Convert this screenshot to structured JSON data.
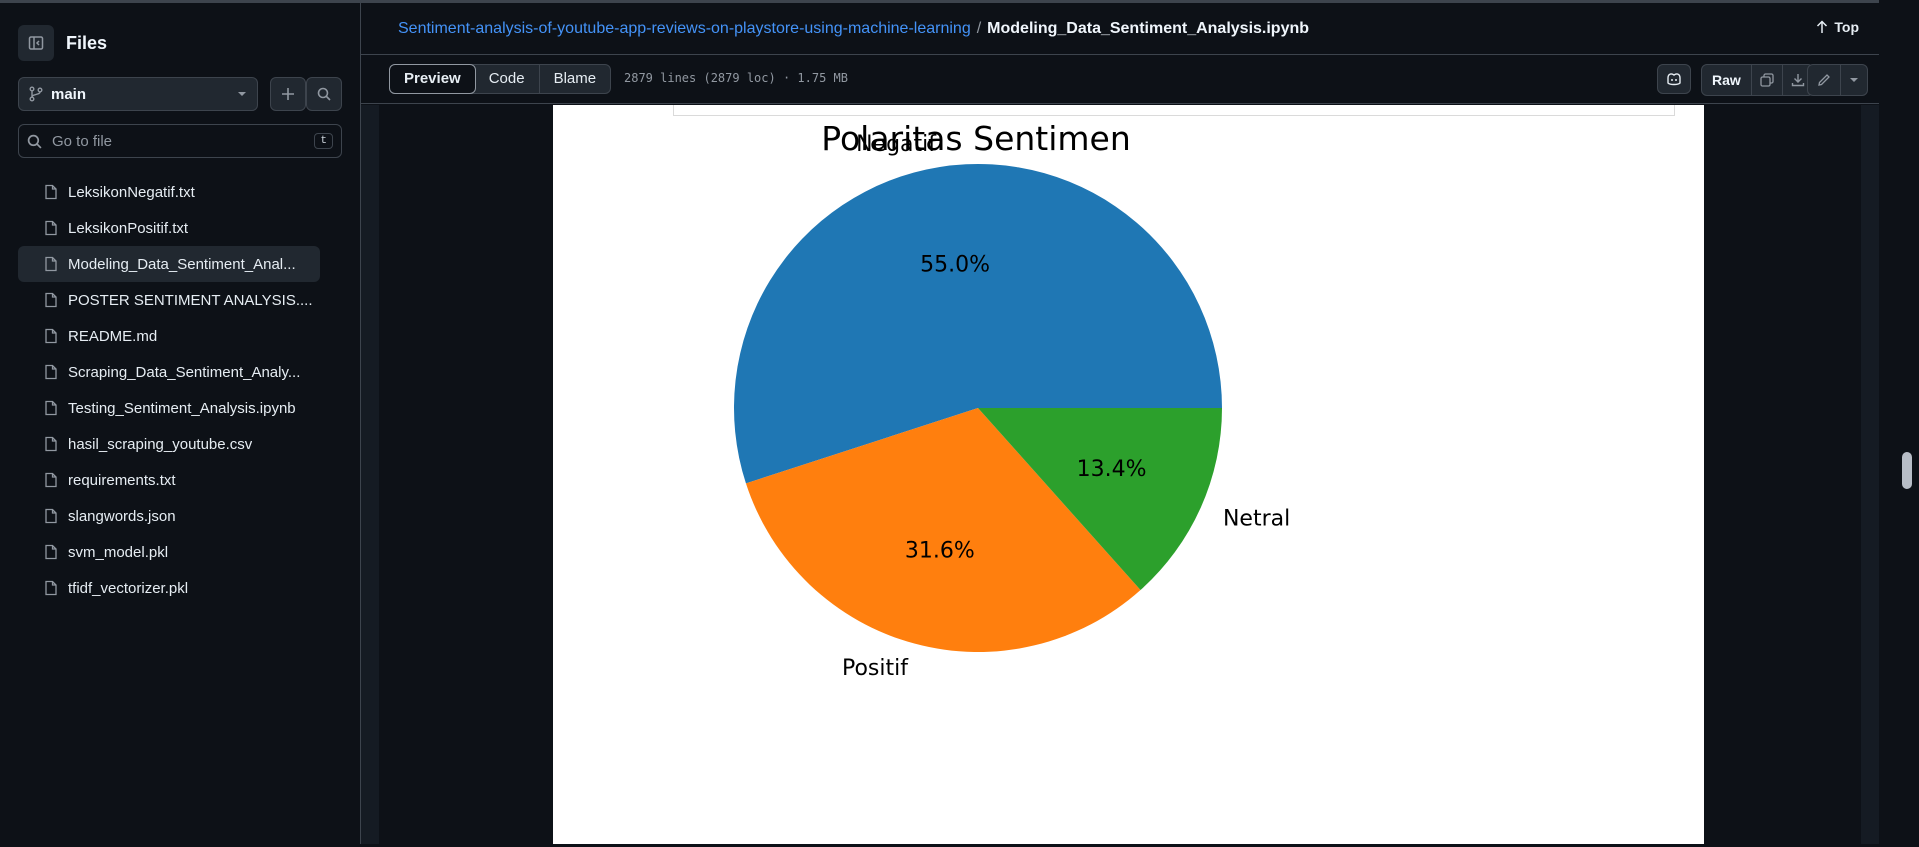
{
  "sidebar": {
    "title": "Files",
    "branch": "main",
    "goto_placeholder": "Go to file",
    "goto_shortcut": "t",
    "files": [
      {
        "name": "LeksikonNegatif.txt",
        "active": false
      },
      {
        "name": "LeksikonPositif.txt",
        "active": false
      },
      {
        "name": "Modeling_Data_Sentiment_Anal...",
        "active": true
      },
      {
        "name": "POSTER SENTIMENT ANALYSIS....",
        "active": false
      },
      {
        "name": "README.md",
        "active": false
      },
      {
        "name": "Scraping_Data_Sentiment_Analy...",
        "active": false
      },
      {
        "name": "Testing_Sentiment_Analysis.ipynb",
        "active": false
      },
      {
        "name": "hasil_scraping_youtube.csv",
        "active": false
      },
      {
        "name": "requirements.txt",
        "active": false
      },
      {
        "name": "slangwords.json",
        "active": false
      },
      {
        "name": "svm_model.pkl",
        "active": false
      },
      {
        "name": "tfidf_vectorizer.pkl",
        "active": false
      }
    ]
  },
  "header": {
    "repo": "Sentiment-analysis-of-youtube-app-reviews-on-playstore-using-machine-learning",
    "separator": "/",
    "file": "Modeling_Data_Sentiment_Analysis.ipynb",
    "top_label": "Top"
  },
  "toolbar": {
    "tabs": [
      "Preview",
      "Code",
      "Blame"
    ],
    "active_tab": "Preview",
    "file_info": "2879 lines (2879 loc) · 1.75 MB",
    "raw_label": "Raw"
  },
  "colors": {
    "accent": "#4493f8",
    "background": "#0d1117"
  },
  "chart_data": {
    "type": "pie",
    "title": "Polaritas Sentimen",
    "categories": [
      "Negatif",
      "Positif",
      "Netral"
    ],
    "values": [
      55.0,
      31.6,
      13.4
    ],
    "value_labels": [
      "55.0%",
      "31.6%",
      "13.4%"
    ],
    "colors": [
      "#1f77b4",
      "#ff7f0e",
      "#2ca02c"
    ],
    "start_angle_deg": 0,
    "direction": "counterclockwise"
  }
}
